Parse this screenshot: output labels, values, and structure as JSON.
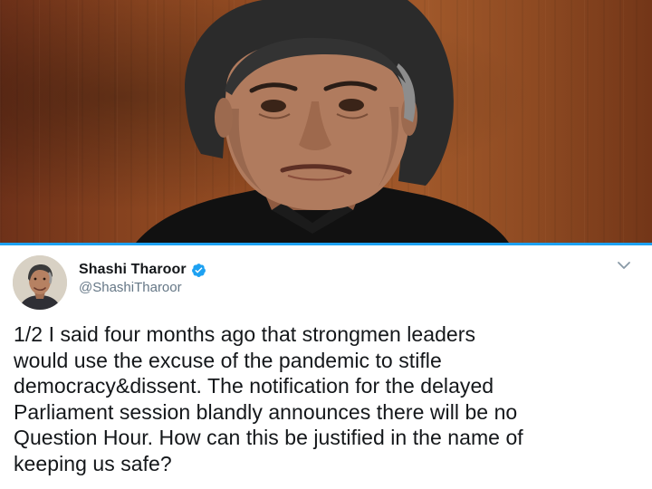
{
  "tweet": {
    "author": {
      "display_name": "Shashi Tharoor",
      "handle": "@ShashiTharoor",
      "verified": true
    },
    "text": "1/2 I said four months ago that strongmen leaders\nwould use the excuse of the pandemic to stifle\ndemocracy&dissent. The notification for the delayed\nParliament session blandly announces there will be no\nQuestion Hour. How can this be justified in the name of\nkeeping us safe?"
  },
  "icons": {
    "verified": "verified-badge-icon",
    "caret": "chevron-down-icon"
  },
  "colors": {
    "accent": "#1da1f2",
    "text": "#14171a",
    "secondary_text": "#657786"
  }
}
